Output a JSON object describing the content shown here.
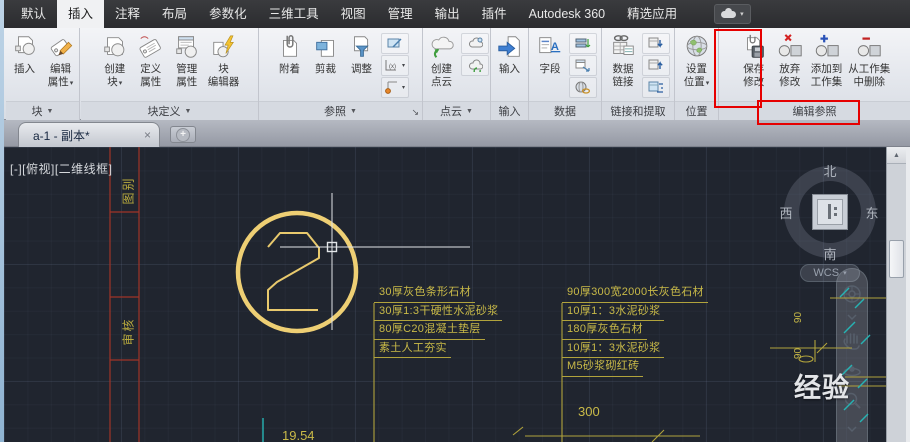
{
  "menu": {
    "tabs": [
      {
        "label": "默认"
      },
      {
        "label": "插入"
      },
      {
        "label": "注释"
      },
      {
        "label": "布局"
      },
      {
        "label": "参数化"
      },
      {
        "label": "三维工具"
      },
      {
        "label": "视图"
      },
      {
        "label": "管理"
      },
      {
        "label": "输出"
      },
      {
        "label": "插件"
      },
      {
        "label": "Autodesk 360"
      },
      {
        "label": "精选应用"
      }
    ]
  },
  "icons": {
    "dropdown": "▾",
    "panel_dropdown": "▼",
    "launcher": "↘",
    "scroll_up": "▲",
    "close": "×",
    "plus": "+"
  },
  "ribbon": {
    "groups": [
      {
        "name": "块",
        "buttons": [
          {
            "lines": [
              "插入"
            ]
          },
          {
            "lines": [
              "编辑",
              "属性"
            ]
          }
        ]
      },
      {
        "name": "块定义",
        "buttons": [
          {
            "lines": [
              "创建",
              "块"
            ]
          },
          {
            "lines": [
              "定义",
              "属性"
            ]
          },
          {
            "lines": [
              "管理",
              "属性"
            ]
          },
          {
            "lines": [
              "块",
              "编辑器"
            ]
          }
        ]
      },
      {
        "name": "参照",
        "buttons": [
          {
            "lines": [
              "附着"
            ]
          },
          {
            "lines": [
              "剪裁"
            ]
          },
          {
            "lines": [
              "调整"
            ]
          }
        ]
      },
      {
        "name": "点云",
        "buttons": [
          {
            "lines": [
              "创建",
              "点云"
            ]
          }
        ]
      },
      {
        "name": "输入",
        "buttons": [
          {
            "lines": [
              "输入"
            ]
          }
        ]
      },
      {
        "name": "数据",
        "buttons": [
          {
            "lines": [
              "字段"
            ]
          }
        ]
      },
      {
        "name": "链接和提取",
        "buttons": [
          {
            "lines": [
              "数据",
              "链接"
            ]
          }
        ]
      },
      {
        "name": "位置",
        "buttons": [
          {
            "lines": [
              "设置",
              "位置"
            ]
          }
        ]
      },
      {
        "name": "编辑参照",
        "buttons": [
          {
            "lines": [
              "保存",
              "修改"
            ]
          },
          {
            "lines": [
              "放弃",
              "修改"
            ]
          },
          {
            "lines": [
              "添加到",
              "工作集"
            ]
          },
          {
            "lines": [
              "从工作集",
              "中删除"
            ]
          }
        ]
      }
    ]
  },
  "tabbar": {
    "title": "a-1 - 副本*"
  },
  "canvas": {
    "viewport_label": "[-][俯视][二维线框]",
    "bubble_number": "2",
    "column_labels": [
      "图别",
      "审核"
    ],
    "notes_mid": [
      "30厚灰色条形石材",
      "30厚1:3干硬性水泥砂浆",
      "80厚C20混凝土垫层",
      "素土人工夯实"
    ],
    "notes_right": [
      "90厚300宽2000长灰色石材",
      "10厚1：3水泥砂浆",
      "180厚灰色石材",
      "10厚1：3水泥砂浆",
      "M5砂浆砌红砖"
    ],
    "dimensions": {
      "d300": "300",
      "d1954": "19.54",
      "d90a": "90",
      "d90b": "90"
    },
    "viewcube": {
      "north": "北",
      "south": "南",
      "west": "西",
      "east": "东"
    },
    "wcs_label": "WCS",
    "watermark": "经验"
  },
  "colors": {
    "cad_yellow": "#c9ba48",
    "circle_yellow": "#eecf74",
    "cad_red": "#a03428",
    "cad_cyan": "#26b3b3",
    "annotation_red": "#e60000"
  }
}
